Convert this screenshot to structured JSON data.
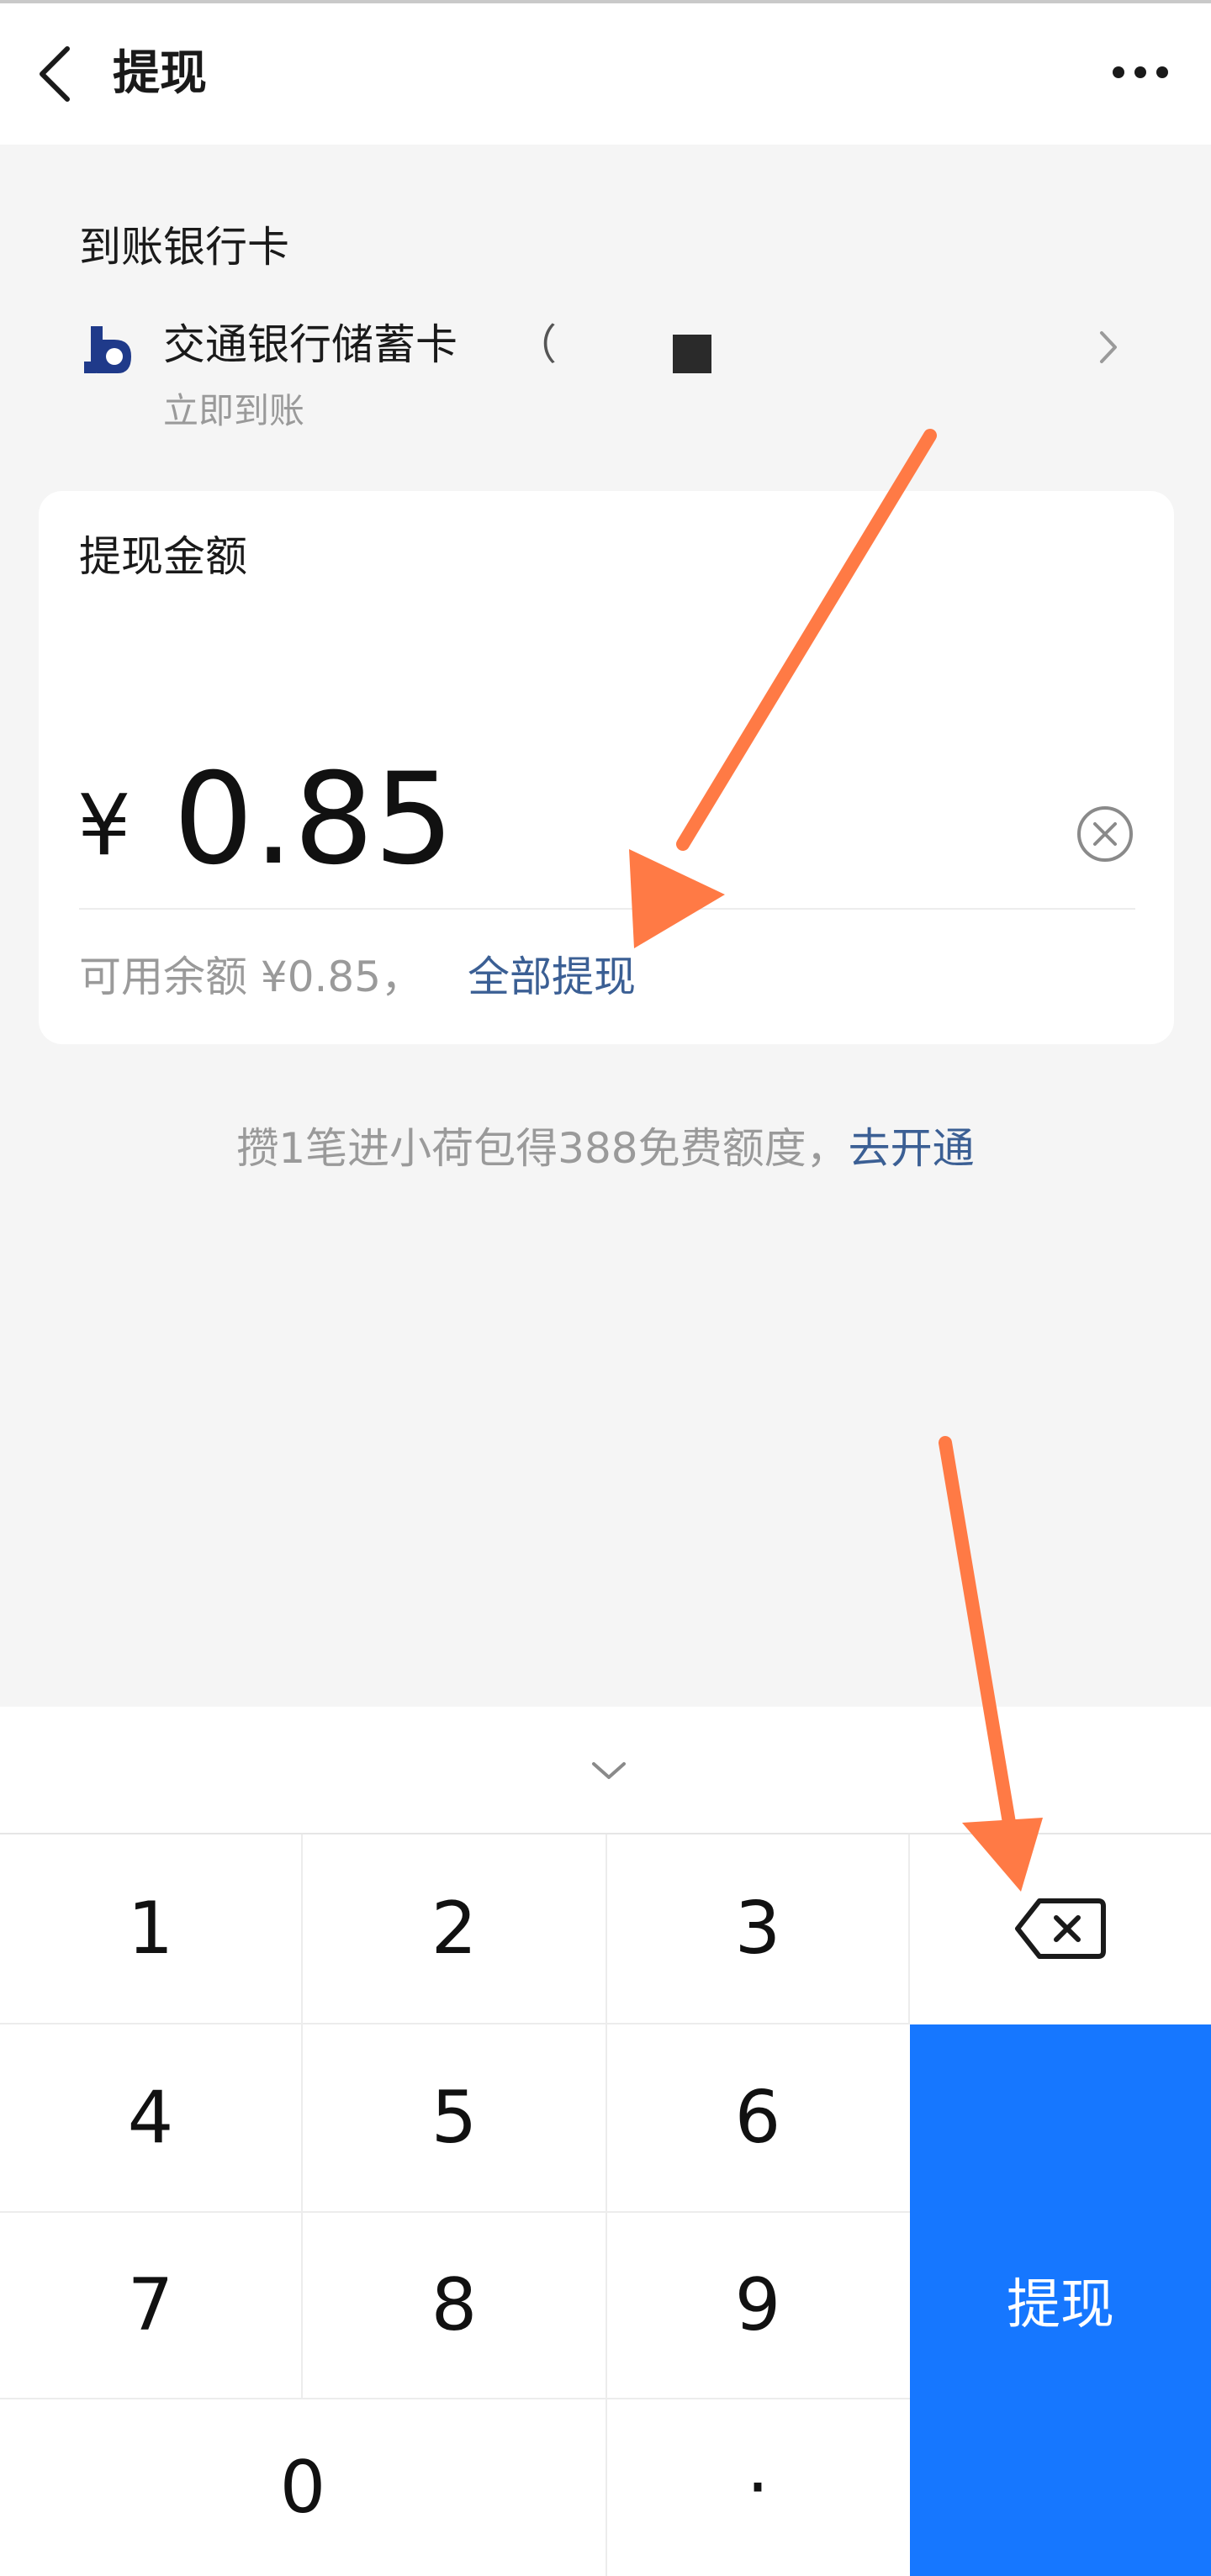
{
  "nav": {
    "title": "提现"
  },
  "bank_section": {
    "label": "到账银行卡",
    "bank_name": "交通银行储蓄卡",
    "bank_tail": "（",
    "arrival": "立即到账"
  },
  "amount_card": {
    "label": "提现金额",
    "currency": "¥",
    "amount": "0.85",
    "balance_prefix": "可用余额 ¥0.85，",
    "withdraw_all": "全部提现"
  },
  "promo": {
    "text": "攒1笔进小荷包得388免费额度，",
    "link": "去开通"
  },
  "keypad": {
    "keys": [
      "1",
      "2",
      "3",
      "4",
      "5",
      "6",
      "7",
      "8",
      "9",
      "0",
      "·"
    ],
    "submit": "提现"
  },
  "colors": {
    "primary": "#1677ff",
    "link": "#3b5f94",
    "annotation_arrow": "#ff7a45"
  },
  "icons": [
    "back-icon",
    "more-icon",
    "bank-logo-icon",
    "chevron-right-icon",
    "clear-icon",
    "collapse-keyboard-icon",
    "backspace-icon"
  ]
}
